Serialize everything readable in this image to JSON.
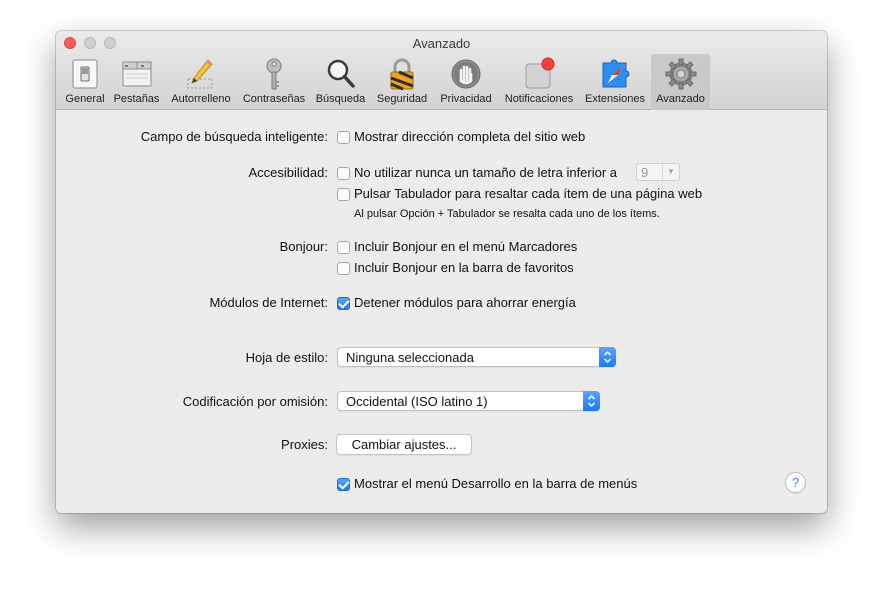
{
  "window": {
    "title": "Avanzado"
  },
  "toolbar": {
    "items": [
      {
        "label": "General",
        "icon": "general-switch-icon"
      },
      {
        "label": "Pestañas",
        "icon": "tabs-icon"
      },
      {
        "label": "Autorrelleno",
        "icon": "pencil-icon"
      },
      {
        "label": "Contraseñas",
        "icon": "key-icon"
      },
      {
        "label": "Búsqueda",
        "icon": "magnifier-icon"
      },
      {
        "label": "Seguridad",
        "icon": "padlock-icon"
      },
      {
        "label": "Privacidad",
        "icon": "hand-icon"
      },
      {
        "label": "Notificaciones",
        "icon": "notification-badge-icon"
      },
      {
        "label": "Extensiones",
        "icon": "compass-puzzle-icon"
      },
      {
        "label": "Avanzado",
        "icon": "gear-icon"
      }
    ],
    "selected": "Avanzado"
  },
  "settings": {
    "smart_search": {
      "label": "Campo de búsqueda inteligente:",
      "option": "Mostrar dirección completa del sitio web",
      "checked": false
    },
    "accessibility": {
      "label": "Accesibilidad:",
      "option_font": "No utilizar nunca un tamaño de letra inferior a",
      "font_size": "9",
      "option_tab": "Pulsar Tabulador para resaltar cada ítem de una página web",
      "note": "Al pulsar Opción + Tabulador se resalta cada uno de los ítems.",
      "font_checked": false,
      "tab_checked": false
    },
    "bonjour": {
      "label": "Bonjour:",
      "option_bookmarks": "Incluir Bonjour en el menú Marcadores",
      "option_favorites": "Incluir Bonjour en la barra de favoritos",
      "bookmarks_checked": false,
      "favorites_checked": false
    },
    "plugins": {
      "label": "Módulos de Internet:",
      "option": "Detener módulos para ahorrar energía",
      "checked": true
    },
    "stylesheet": {
      "label": "Hoja de estilo:",
      "value": "Ninguna seleccionada"
    },
    "encoding": {
      "label": "Codificación por omisión:",
      "value": "Occidental (ISO latino 1)"
    },
    "proxies": {
      "label": "Proxies:",
      "button": "Cambiar ajustes..."
    },
    "develop_menu": {
      "option": "Mostrar el menú Desarrollo en la barra de menús",
      "checked": true
    },
    "help": "?"
  },
  "colors": {
    "accent": "#1e7bf2",
    "close_button": "#fc605c",
    "notification_dot": "#fc3d39"
  }
}
